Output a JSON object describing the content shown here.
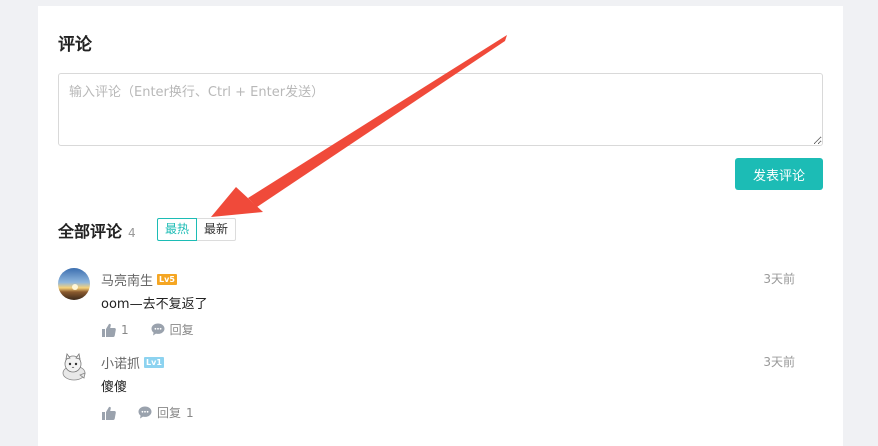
{
  "comment_section": {
    "title": "评论",
    "input_placeholder": "输入评论（Enter换行、Ctrl + Enter发送）",
    "submit_label": "发表评论"
  },
  "all_comments": {
    "title": "全部评论",
    "count": "4",
    "sort_tabs": [
      "最热",
      "最新"
    ],
    "active_tab": "最热"
  },
  "comments": [
    {
      "username": "马亮南生",
      "level": "Lv5",
      "level_color": "#f5a623",
      "time": "3天前",
      "text": "oom—去不复返了",
      "likes": "1",
      "reply_label": "回复",
      "reply_count": ""
    },
    {
      "username": "小诺抓",
      "level": "Lv1",
      "level_color": "#8dd3f0",
      "time": "3天前",
      "text": "傻傻",
      "likes": "",
      "reply_label": "回复",
      "reply_count": "1"
    }
  ],
  "colors": {
    "accent": "#1cbcb5",
    "annotation_arrow": "#f04a3a"
  },
  "icons": [
    "thumbs-up-icon",
    "speech-bubble-icon"
  ]
}
